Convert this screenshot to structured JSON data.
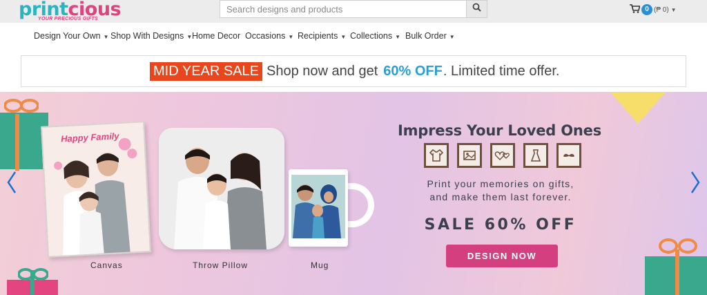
{
  "brand": {
    "logo_part1": "print",
    "logo_part2": "cious",
    "tagline": "YOUR PRECIOUS GIFTS"
  },
  "search": {
    "placeholder": "Search designs and products",
    "icon": "search-icon"
  },
  "cart": {
    "icon": "cart-icon",
    "count": "0",
    "total": "(₱ 0)"
  },
  "nav": {
    "items": [
      {
        "label": "Design Your Own",
        "dropdown": true
      },
      {
        "label": "Shop With Designs",
        "dropdown": true
      },
      {
        "label": "Home Decor",
        "dropdown": false
      },
      {
        "label": "Occasions",
        "dropdown": true
      },
      {
        "label": "Recipients",
        "dropdown": true
      },
      {
        "label": "Collections",
        "dropdown": true
      },
      {
        "label": "Bulk Order",
        "dropdown": true
      }
    ]
  },
  "promo": {
    "sale_tag": "MID YEAR SALE",
    "text_before": "Shop now and get",
    "discount": "60% OFF",
    "text_after": ". Limited time offer."
  },
  "banner": {
    "headline": "Impress Your Loved Ones",
    "subtext_line1": "Print your memories on gifts,",
    "subtext_line2": "and make them last forever.",
    "sale_text": "SALE 60% OFF",
    "cta_label": "DESIGN NOW",
    "canvas_title": "Happy Family",
    "products": [
      {
        "label": "Canvas"
      },
      {
        "label": "Throw Pillow"
      },
      {
        "label": "Mug"
      }
    ]
  },
  "colors": {
    "brand_teal": "#2bb3c0",
    "brand_pink": "#e0427f",
    "sale_orange": "#e8471d",
    "discount_blue": "#2a9fd3",
    "cta_pink": "#d4407f",
    "arrow_blue": "#1e6fd0"
  }
}
